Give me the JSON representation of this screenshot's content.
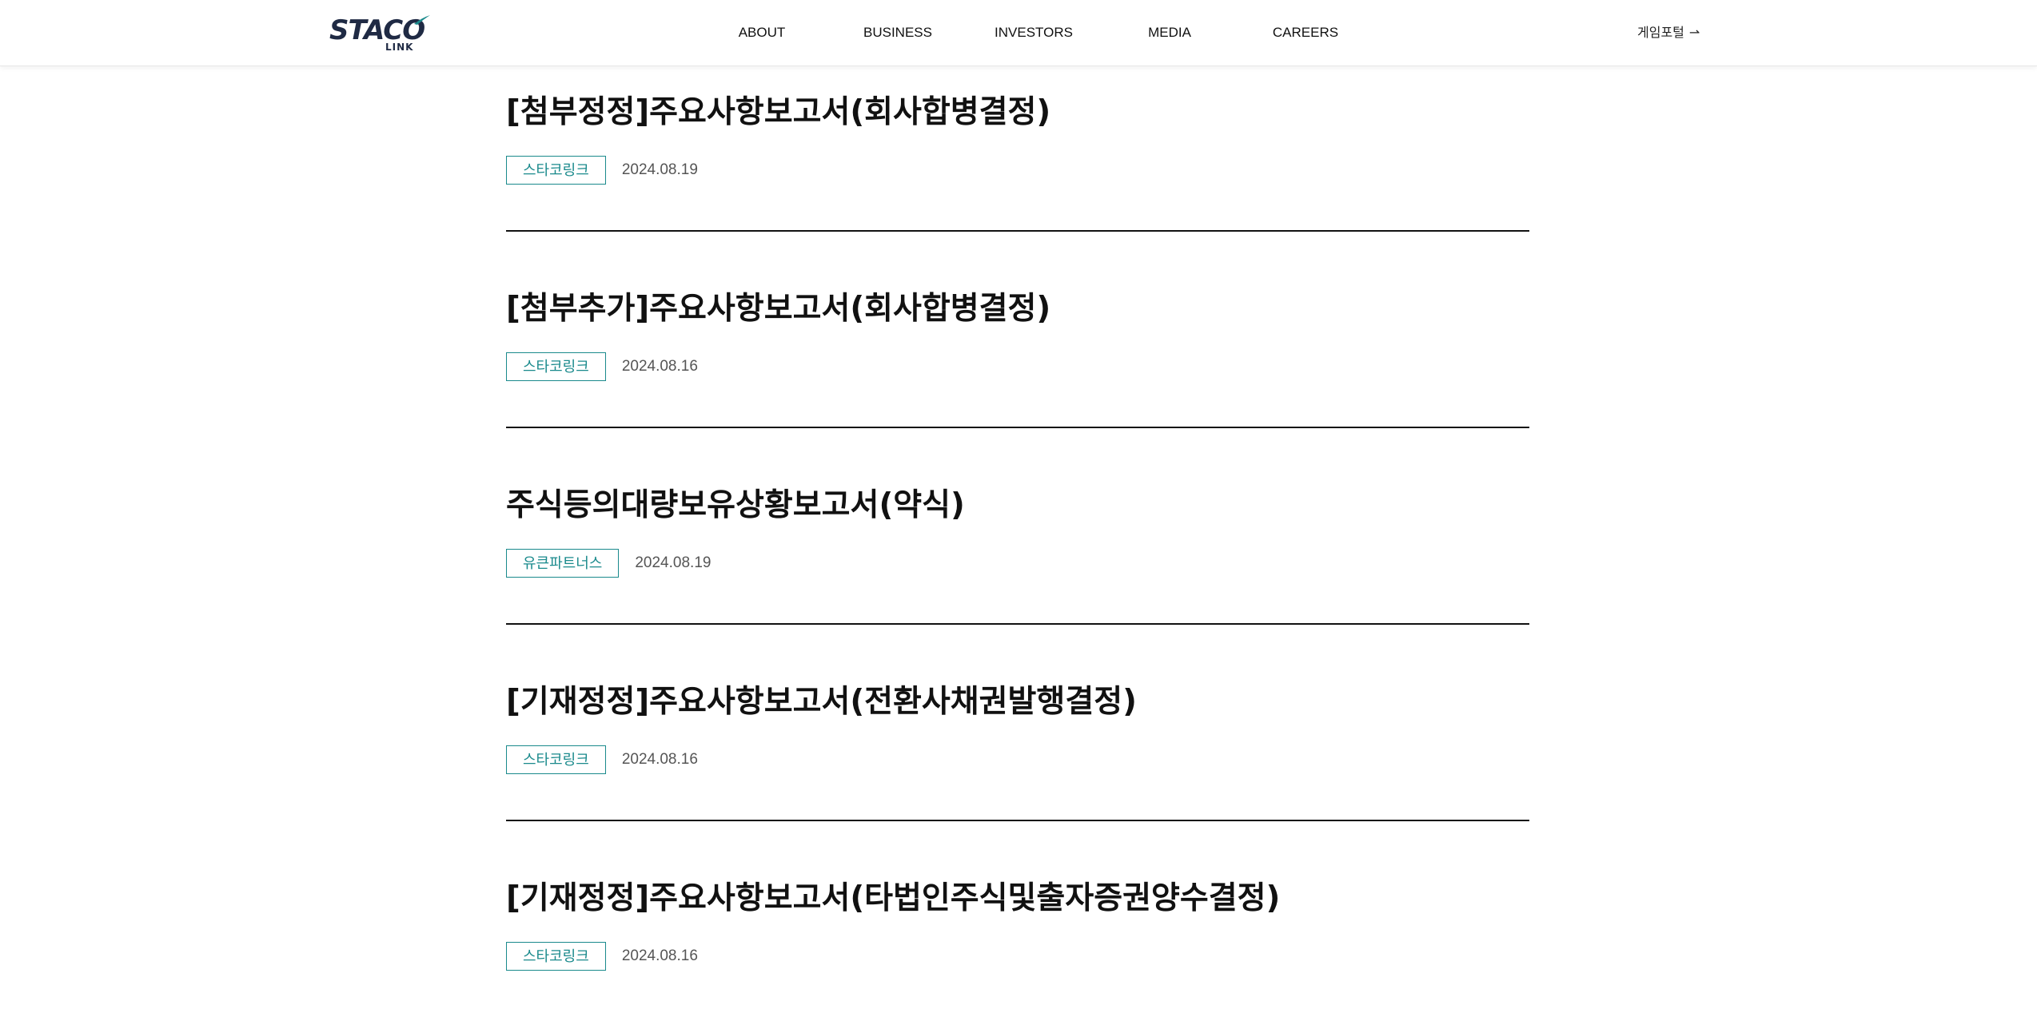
{
  "header": {
    "logo_text": "STACO",
    "logo_sub": "LINK",
    "nav": [
      {
        "label": "ABOUT"
      },
      {
        "label": "BUSINESS"
      },
      {
        "label": "INVESTORS"
      },
      {
        "label": "MEDIA"
      },
      {
        "label": "CAREERS"
      }
    ],
    "portal_label": "게임포털",
    "portal_arrow": "⇀"
  },
  "colors": {
    "accent": "#1a8a8c",
    "logo": "#1f2a44"
  },
  "items": [
    {
      "title": "[첨부정정]주요사항보고서(회사합병결정)",
      "badge": "스타코링크",
      "date": "2024.08.19"
    },
    {
      "title": "[첨부추가]주요사항보고서(회사합병결정)",
      "badge": "스타코링크",
      "date": "2024.08.16"
    },
    {
      "title": "주식등의대량보유상황보고서(약식)",
      "badge": "유큰파트너스",
      "date": "2024.08.19"
    },
    {
      "title": "[기재정정]주요사항보고서(전환사채권발행결정)",
      "badge": "스타코링크",
      "date": "2024.08.16"
    },
    {
      "title": "[기재정정]주요사항보고서(타법인주식및출자증권양수결정)",
      "badge": "스타코링크",
      "date": "2024.08.16"
    }
  ]
}
